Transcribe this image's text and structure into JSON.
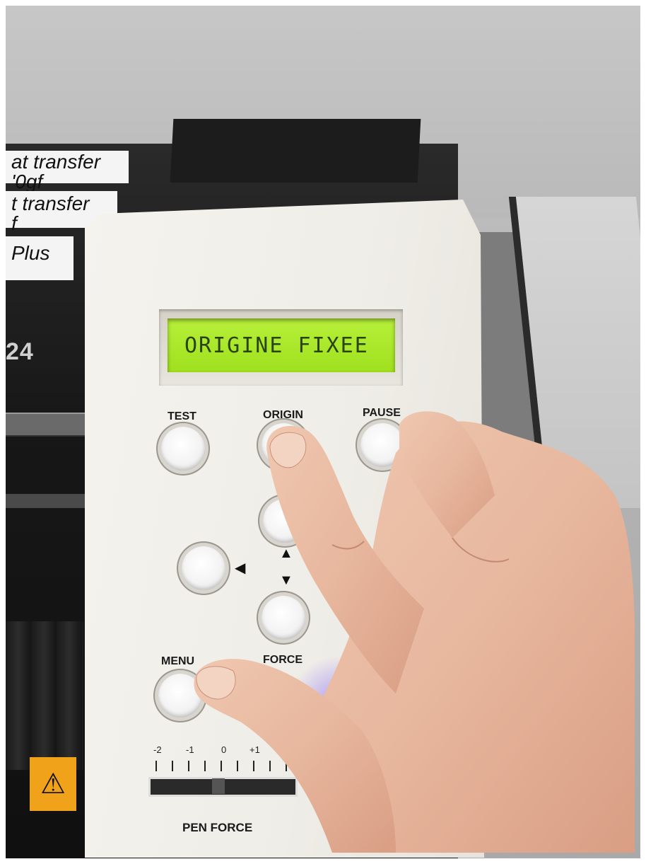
{
  "stickers": [
    "at transfer",
    "'0gf",
    "t transfer",
    "f",
    "Plus"
  ],
  "model_text": "24",
  "display": {
    "text": "ORIGINE FIXEE"
  },
  "buttons": {
    "test": "TEST",
    "origin": "ORIGIN",
    "pause": "PAUSE",
    "menu": "MENU",
    "force": "FORCE"
  },
  "arrows": {
    "left": "◀",
    "up": "▲",
    "down": "▼"
  },
  "pen_force": {
    "label": "PEN FORCE",
    "scale": [
      "-2",
      "-1",
      "0",
      "+1"
    ]
  },
  "warning_symbol": "⚠"
}
